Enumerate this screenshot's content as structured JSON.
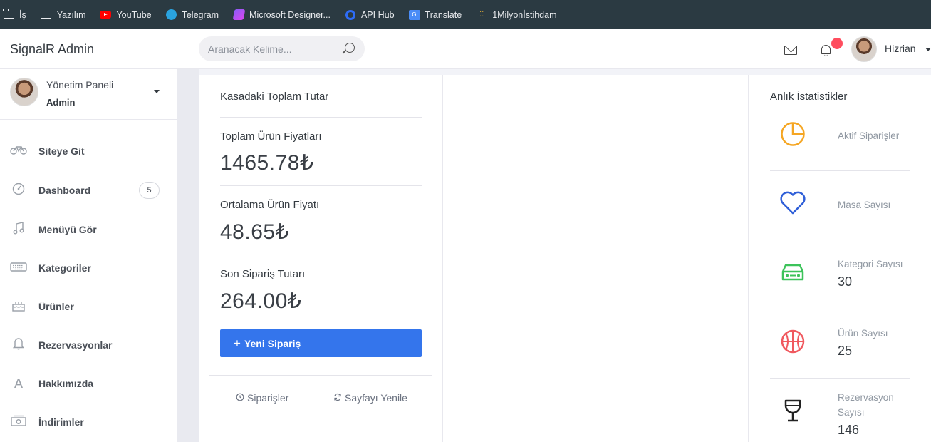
{
  "bookmarks": [
    {
      "label": "İş",
      "icon": "folder-icon"
    },
    {
      "label": "Yazılım",
      "icon": "folder-icon"
    },
    {
      "label": "YouTube",
      "icon": "youtube-icon"
    },
    {
      "label": "Telegram",
      "icon": "telegram-icon"
    },
    {
      "label": "Microsoft Designer...",
      "icon": "microsoft-designer-icon"
    },
    {
      "label": "API Hub",
      "icon": "api-hub-icon"
    },
    {
      "label": "Translate",
      "icon": "translate-icon"
    },
    {
      "label": "1Milyonİstihdam",
      "icon": "dots-icon"
    }
  ],
  "header": {
    "brand": "SignalR Admin",
    "search_placeholder": "Aranacak Kelime...",
    "username": "Hizrian"
  },
  "sidebar": {
    "profile_name": "Yönetim Paneli",
    "profile_role": "Admin",
    "items": [
      {
        "label": "Siteye Git",
        "icon": "bicycle-icon"
      },
      {
        "label": "Dashboard",
        "icon": "dashboard-icon",
        "badge": "5"
      },
      {
        "label": "Menüyü Gör",
        "icon": "music-icon"
      },
      {
        "label": "Kategoriler",
        "icon": "keyboard-icon"
      },
      {
        "label": "Ürünler",
        "icon": "cake-icon"
      },
      {
        "label": "Rezervasyonlar",
        "icon": "bell-icon"
      },
      {
        "label": "Hakkımızda",
        "icon": "letter-a-icon"
      },
      {
        "label": "İndirimler",
        "icon": "cash-icon"
      }
    ]
  },
  "summary": {
    "title": "Kasadaki Toplam Tutar",
    "total_label": "Toplam Ürün Fiyatları",
    "total_value": "1465.78₺",
    "avg_label": "Ortalama Ürün Fiyatı",
    "avg_value": "48.65₺",
    "last_label": "Son Sipariş Tutarı",
    "last_value": "264.00₺",
    "new_order": "Yeni Sipariş",
    "orders_link": "Siparişler",
    "refresh_link": "Sayfayı Yenile"
  },
  "stats": {
    "title": "Anlık İstatistikler",
    "items": [
      {
        "label": "Aktif Siparişler",
        "value": "",
        "icon": "pie-chart-icon",
        "color": "#f5a623"
      },
      {
        "label": "Masa Sayısı",
        "value": "",
        "icon": "heart-icon",
        "color": "#2f5fd8"
      },
      {
        "label": "Kategori Sayısı",
        "value": "30",
        "icon": "car-icon",
        "color": "#3cc35a"
      },
      {
        "label": "Ürün Sayısı",
        "value": "25",
        "icon": "basketball-icon",
        "color": "#f0595f"
      },
      {
        "label": "Rezervasyon Sayısı",
        "value": "146",
        "icon": "wine-glass-icon",
        "color": "#222222"
      }
    ]
  }
}
